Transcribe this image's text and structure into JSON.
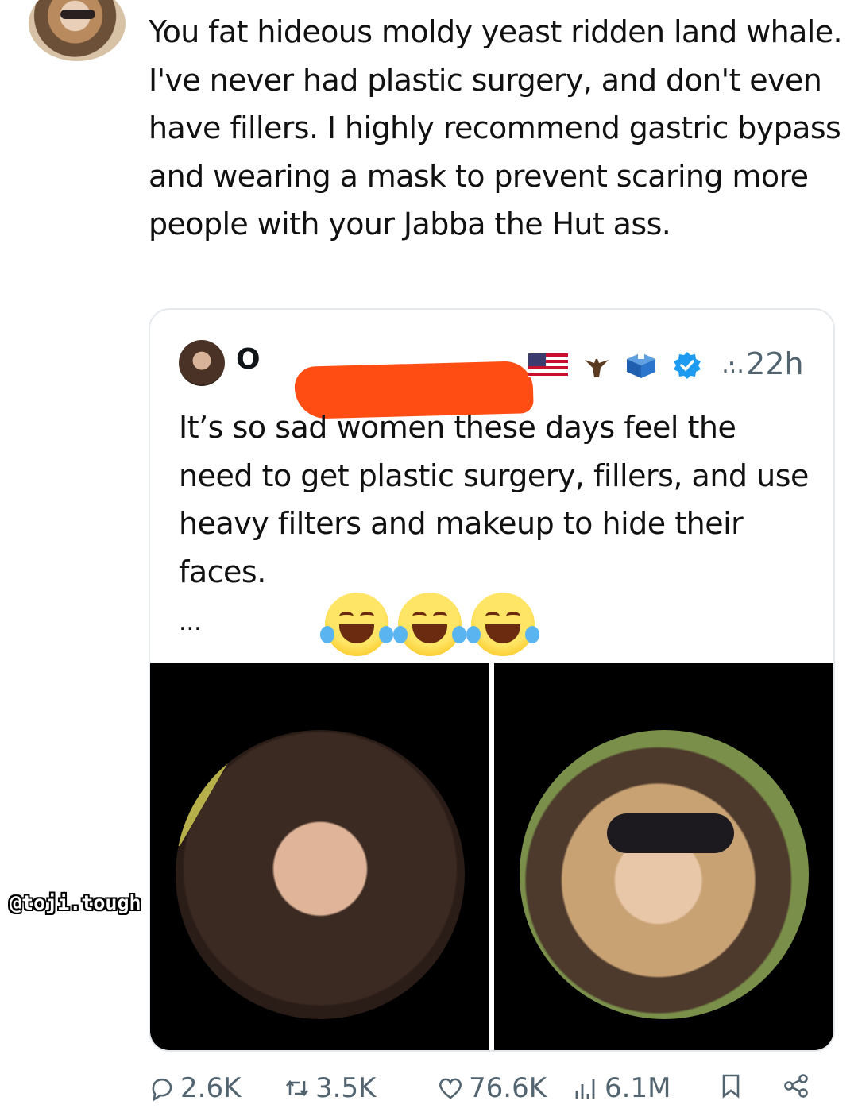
{
  "post": {
    "text": "You fat hideous moldy yeast ridden land whale. I've never had plastic surgery, and don't even have fillers. I highly recommend gastric bypass and wearing a mask to prevent scaring more people with your Jabba the Hut ass."
  },
  "quote": {
    "name_visible": "O",
    "more": "...",
    "time": "· 22h",
    "text": "It’s so sad women these days feel the need to get plastic surgery, fillers, and use heavy filters and makeup to hide their faces.",
    "ellipsis": "..."
  },
  "actions": {
    "replies": "2.6K",
    "reposts": "3.5K",
    "likes": "76.6K",
    "views": "6.1M"
  },
  "watermark": "@toji.tough",
  "colors": {
    "redaction": "#ff4d14",
    "verified": "#1d9bf0",
    "muted": "#536471"
  },
  "icons": [
    "reply-icon",
    "repost-icon",
    "like-icon",
    "views-icon",
    "bookmark-icon",
    "share-icon",
    "verified-badge-icon",
    "us-flag-icon",
    "eagle-icon",
    "ballot-box-icon"
  ]
}
